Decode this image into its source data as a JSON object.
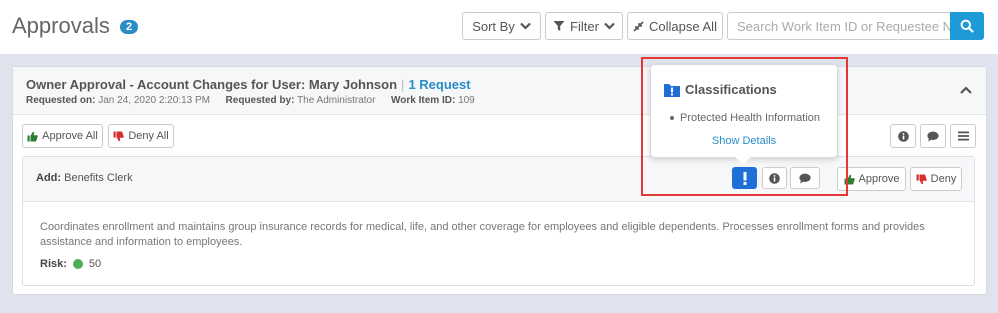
{
  "header": {
    "title": "Approvals",
    "count": "2",
    "sort_label": "Sort By",
    "filter_label": "Filter",
    "collapse_label": "Collapse All",
    "search_placeholder": "Search Work Item ID or Requestee Name"
  },
  "request": {
    "title": "Owner Approval - Account Changes for User: Mary Johnson",
    "separator": "|",
    "request_count": "1 Request",
    "requested_on_label": "Requested on:",
    "requested_on": "Jan 24, 2020 2:20:13 PM",
    "requested_by_label": "Requested by:",
    "requested_by": "The Administrator",
    "work_item_label": "Work Item ID:",
    "work_item_id": "109",
    "approve_all": "Approve All",
    "deny_all": "Deny All"
  },
  "item": {
    "action_label": "Add:",
    "entitlement": "Benefits Clerk",
    "description": "Coordinates enrollment and maintains group insurance records for medical, life, and other coverage for employees and eligible dependents. Processes enrollment forms and provides assistance and information to employees.",
    "risk_label": "Risk:",
    "risk_value": "50",
    "approve": "Approve",
    "deny": "Deny"
  },
  "popover": {
    "title": "Classifications",
    "items": [
      "Protected Health Information"
    ],
    "link": "Show Details"
  },
  "colors": {
    "accent": "#2a8dc7",
    "search_button": "#1e9bd7",
    "classification": "#1e6fd6",
    "approve_icon": "#2e7d32",
    "deny_icon": "#d32f2f",
    "risk_low": "#4caf50",
    "highlight": "#e53935"
  }
}
